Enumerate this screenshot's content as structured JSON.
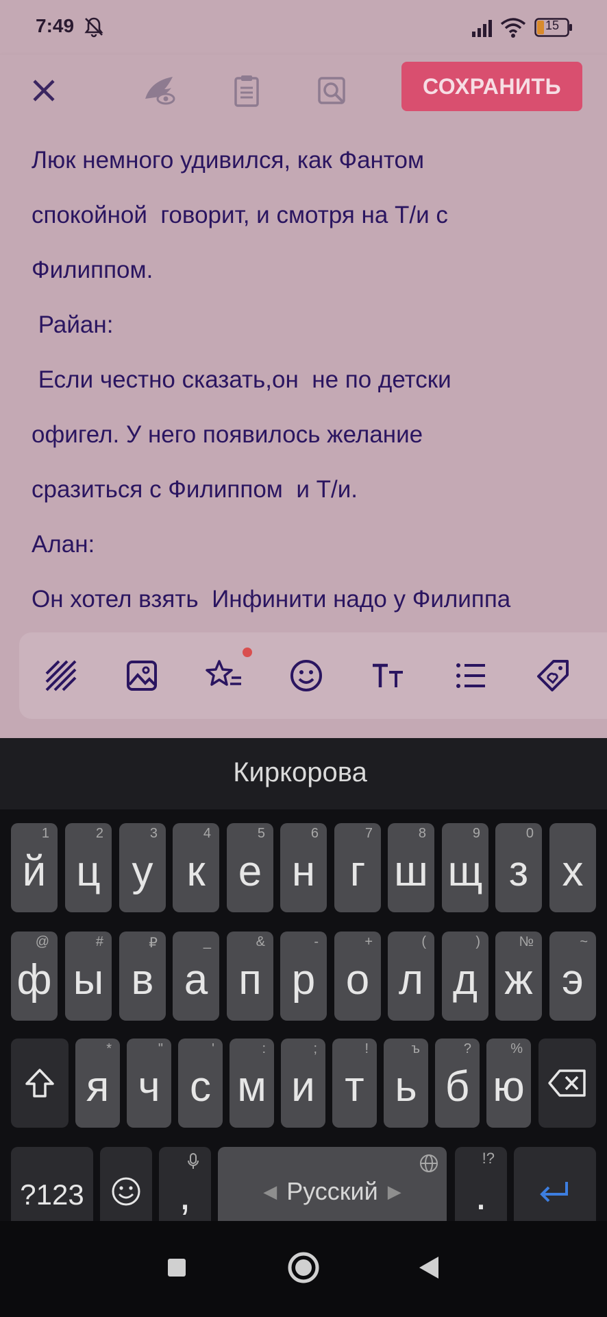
{
  "status": {
    "time": "7:49",
    "battery": "15"
  },
  "toolbar": {
    "save_label": "СОХРАНИТЬ"
  },
  "editor": {
    "lines": [
      "Люк немного удивился, как Фантом",
      "спокойной  говорит, и смотря на Т/и с",
      "Филиппом.",
      " Райан:",
      " Если честно сказать,он  не по детски",
      "офигел. У него появилось желание",
      "сразиться с Филиппом  и Т/и.",
      "Алан:",
      "Он хотел взять  Инфинити надо у Филиппа"
    ]
  },
  "keyboard": {
    "suggestion": "Киркорова",
    "row1": [
      {
        "k": "й",
        "h": "1"
      },
      {
        "k": "ц",
        "h": "2"
      },
      {
        "k": "у",
        "h": "3"
      },
      {
        "k": "к",
        "h": "4"
      },
      {
        "k": "е",
        "h": "5"
      },
      {
        "k": "н",
        "h": "6"
      },
      {
        "k": "г",
        "h": "7"
      },
      {
        "k": "ш",
        "h": "8"
      },
      {
        "k": "щ",
        "h": "9"
      },
      {
        "k": "з",
        "h": "0"
      },
      {
        "k": "х",
        "h": ""
      }
    ],
    "row2": [
      {
        "k": "ф",
        "h": "@"
      },
      {
        "k": "ы",
        "h": "#"
      },
      {
        "k": "в",
        "h": "₽"
      },
      {
        "k": "а",
        "h": "_"
      },
      {
        "k": "п",
        "h": "&"
      },
      {
        "k": "р",
        "h": "-"
      },
      {
        "k": "о",
        "h": "+"
      },
      {
        "k": "л",
        "h": "("
      },
      {
        "k": "д",
        "h": ")"
      },
      {
        "k": "ж",
        "h": "№"
      },
      {
        "k": "э",
        "h": "~"
      }
    ],
    "row3": [
      {
        "k": "я",
        "h": "*"
      },
      {
        "k": "ч",
        "h": "\""
      },
      {
        "k": "с",
        "h": "'"
      },
      {
        "k": "м",
        "h": ":"
      },
      {
        "k": "и",
        "h": ";"
      },
      {
        "k": "т",
        "h": "!"
      },
      {
        "k": "ь",
        "h": "ъ"
      },
      {
        "k": "б",
        "h": "?"
      },
      {
        "k": "ю",
        "h": "%"
      }
    ],
    "symbols_label": "?123",
    "comma": ",",
    "space_label": "Русский",
    "period": ".",
    "period_hint": "!?"
  },
  "colors": {
    "accent": "#d94f6f",
    "text": "#2a1560",
    "enter": "#3d7ee0"
  }
}
